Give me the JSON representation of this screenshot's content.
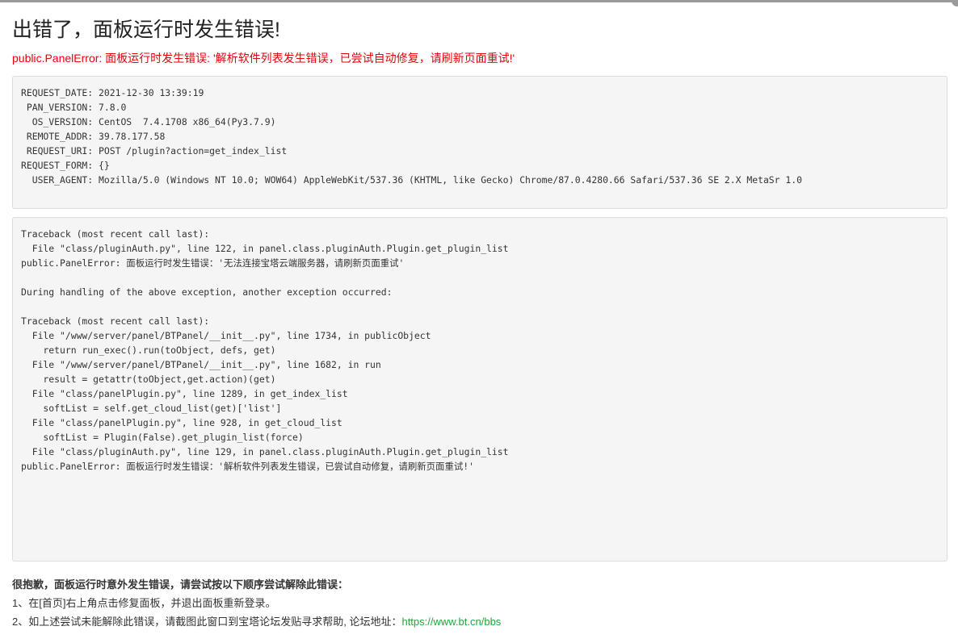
{
  "page": {
    "title": "出错了，面板运行时发生错误!",
    "error_message": "public.PanelError: 面板运行时发生错误: '解析软件列表发生错误，已尝试自动修复，请刷新页面重试!'"
  },
  "request_info": [
    {
      "key": "REQUEST_DATE",
      "value": "2021-12-30 13:39:19",
      "line": "REQUEST_DATE: 2021-12-30 13:39:19"
    },
    {
      "key": "PAN_VERSION",
      "value": "7.8.0",
      "line": " PAN_VERSION: 7.8.0"
    },
    {
      "key": "OS_VERSION",
      "value": "CentOS  7.4.1708 x86_64(Py3.7.9)",
      "line": "  OS_VERSION: CentOS  7.4.1708 x86_64(Py3.7.9)"
    },
    {
      "key": "REMOTE_ADDR",
      "value": "39.78.177.58",
      "line": " REMOTE_ADDR: 39.78.177.58"
    },
    {
      "key": "REQUEST_URI",
      "value": "POST /plugin?action=get_index_list",
      "line": " REQUEST_URI: POST /plugin?action=get_index_list"
    },
    {
      "key": "REQUEST_FORM",
      "value": "{}",
      "line": "REQUEST_FORM: {}"
    },
    {
      "key": "USER_AGENT",
      "value": "Mozilla/5.0 (Windows NT 10.0; WOW64) AppleWebKit/537.36 (KHTML, like Gecko) Chrome/87.0.4280.66 Safari/537.36 SE 2.X MetaSr 1.0",
      "line": "  USER_AGENT: Mozilla/5.0 (Windows NT 10.0; WOW64) AppleWebKit/537.36 (KHTML, like Gecko) Chrome/87.0.4280.66 Safari/537.36 SE 2.X MetaSr 1.0"
    }
  ],
  "traceback": [
    "Traceback (most recent call last):",
    "  File \"class/pluginAuth.py\", line 122, in panel.class.pluginAuth.Plugin.get_plugin_list",
    "public.PanelError: 面板运行时发生错误：'无法连接宝塔云端服务器，请刷新页面重试'",
    "",
    "During handling of the above exception, another exception occurred:",
    "",
    "Traceback (most recent call last):",
    "  File \"/www/server/panel/BTPanel/__init__.py\", line 1734, in publicObject",
    "    return run_exec().run(toObject, defs, get)",
    "  File \"/www/server/panel/BTPanel/__init__.py\", line 1682, in run",
    "    result = getattr(toObject,get.action)(get)",
    "  File \"class/panelPlugin.py\", line 1289, in get_index_list",
    "    softList = self.get_cloud_list(get)['list']",
    "  File \"class/panelPlugin.py\", line 928, in get_cloud_list",
    "    softList = Plugin(False).get_plugin_list(force)",
    "  File \"class/pluginAuth.py\", line 129, in panel.class.pluginAuth.Plugin.get_plugin_list",
    "public.PanelError: 面板运行时发生错误：'解析软件列表发生错误，已尝试自动修复，请刷新页面重试!'"
  ],
  "help": {
    "title": "很抱歉，面板运行时意外发生错误，请尝试按以下顺序尝试解除此错误：",
    "step1": "1、在[首页]右上角点击修复面板，并退出面板重新登录。",
    "step2_text": "2、如上述尝试未能解除此错误，请截图此窗口到宝塔论坛发贴寻求帮助, 论坛地址：",
    "forum_link": "https://www.bt.cn/bbs"
  },
  "colors": {
    "error": "#e8000b",
    "link": "#20a53a",
    "box_bg": "#f5f5f5"
  }
}
